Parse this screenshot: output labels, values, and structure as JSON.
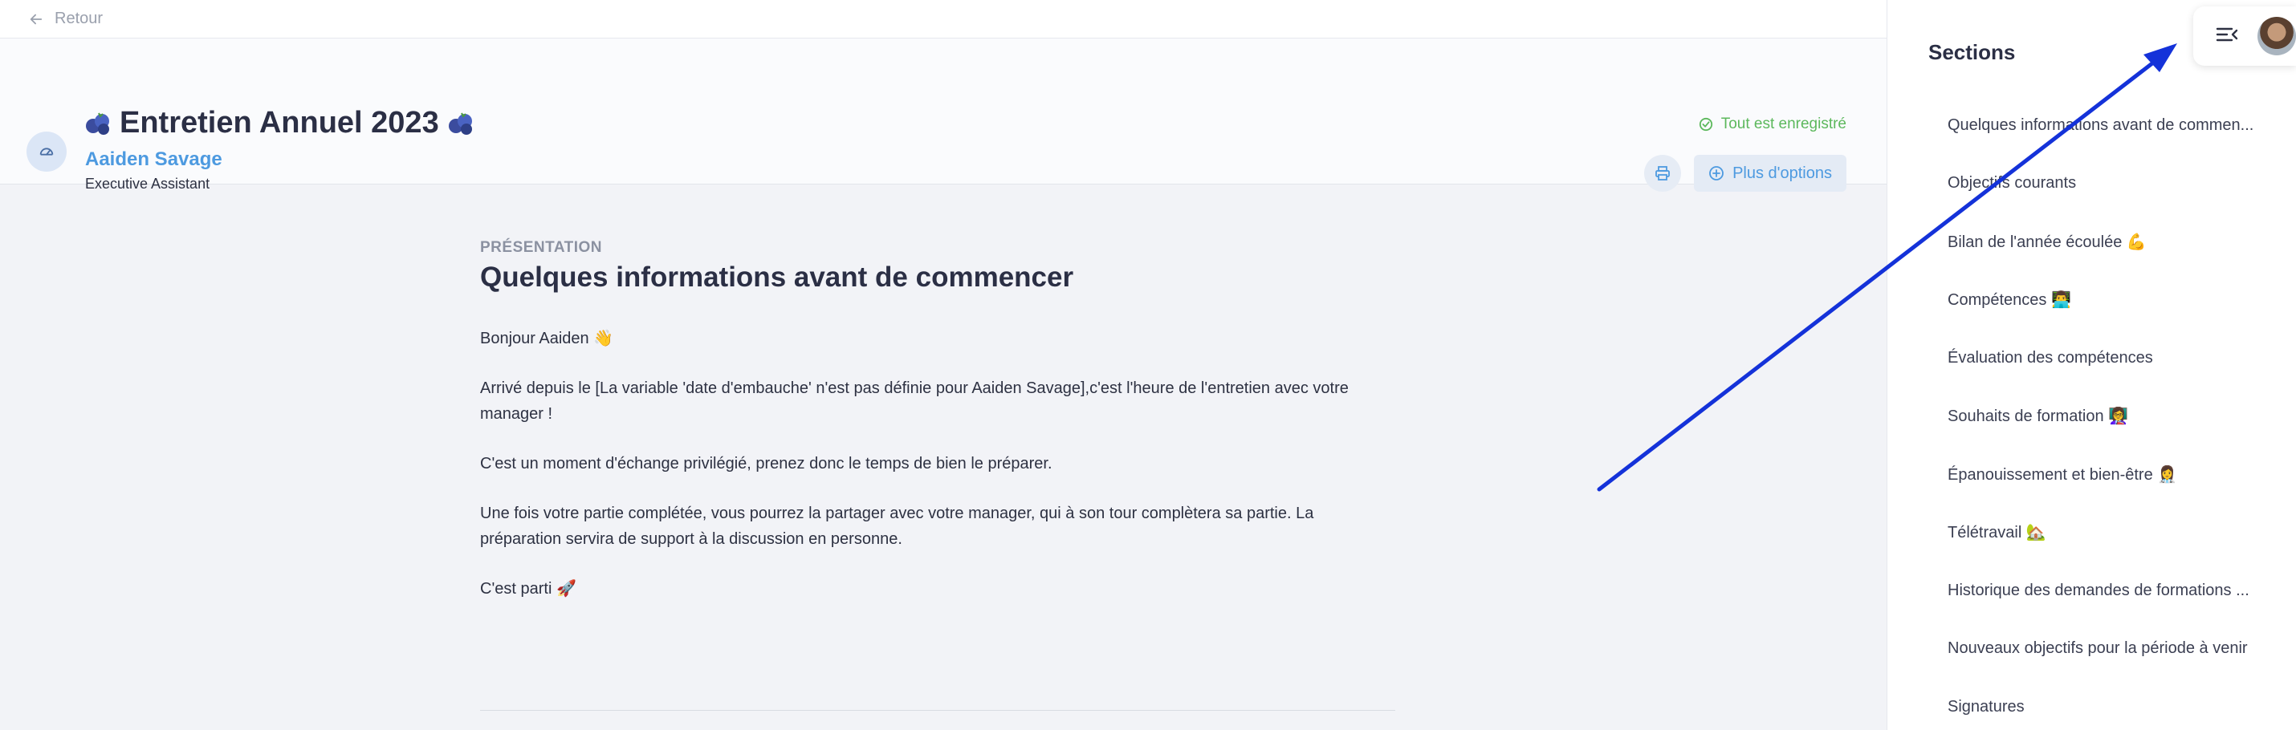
{
  "topbar": {
    "back_label": "Retour"
  },
  "header": {
    "title": "Entretien Annuel 2023",
    "employee_name": "Aaiden Savage",
    "employee_role": "Executive Assistant",
    "save_status": "Tout est enregistré",
    "more_options_label": "Plus d'options"
  },
  "section": {
    "eyebrow": "PRÉSENTATION",
    "title": "Quelques informations avant de commencer",
    "paragraphs": [
      "Bonjour Aaiden 👋",
      "Arrivé depuis le [La variable 'date d'embauche' n'est pas définie pour Aaiden Savage],c'est l'heure de l'entretien avec votre manager !",
      "C'est un moment d'échange privilégié, prenez donc le temps de bien le préparer.",
      "Une fois votre partie complétée, vous pourrez la partager avec votre manager, qui à son tour complètera sa partie. La préparation servira de support à la discussion en personne.",
      "C'est parti 🚀"
    ]
  },
  "sidebar": {
    "title": "Sections",
    "items": [
      {
        "label": "Quelques informations avant de commen..."
      },
      {
        "label": "Objectifs courants"
      },
      {
        "label": "Bilan de l'année écoulée 💪"
      },
      {
        "label": "Compétences 👨‍💻"
      },
      {
        "label": "Évaluation des compétences"
      },
      {
        "label": "Souhaits de formation 👩‍🏫"
      },
      {
        "label": "Épanouissement et bien-être 👩‍⚕️"
      },
      {
        "label": "Télétravail 🏡"
      },
      {
        "label": "Historique des demandes de formations ..."
      },
      {
        "label": "Nouveaux objectifs pour la période à venir"
      },
      {
        "label": "Signatures"
      }
    ]
  },
  "colors": {
    "accent": "#4d9ae0",
    "success": "#5cb85c",
    "annotation_arrow": "#1432d9"
  },
  "icons": {
    "back": "arrow-left-icon",
    "header": "gauge-icon",
    "title_emoji": "blueberries-icon",
    "saved": "check-circle-icon",
    "print": "printer-icon",
    "more": "plus-circle-icon",
    "menu": "menu-collapse-icon"
  }
}
